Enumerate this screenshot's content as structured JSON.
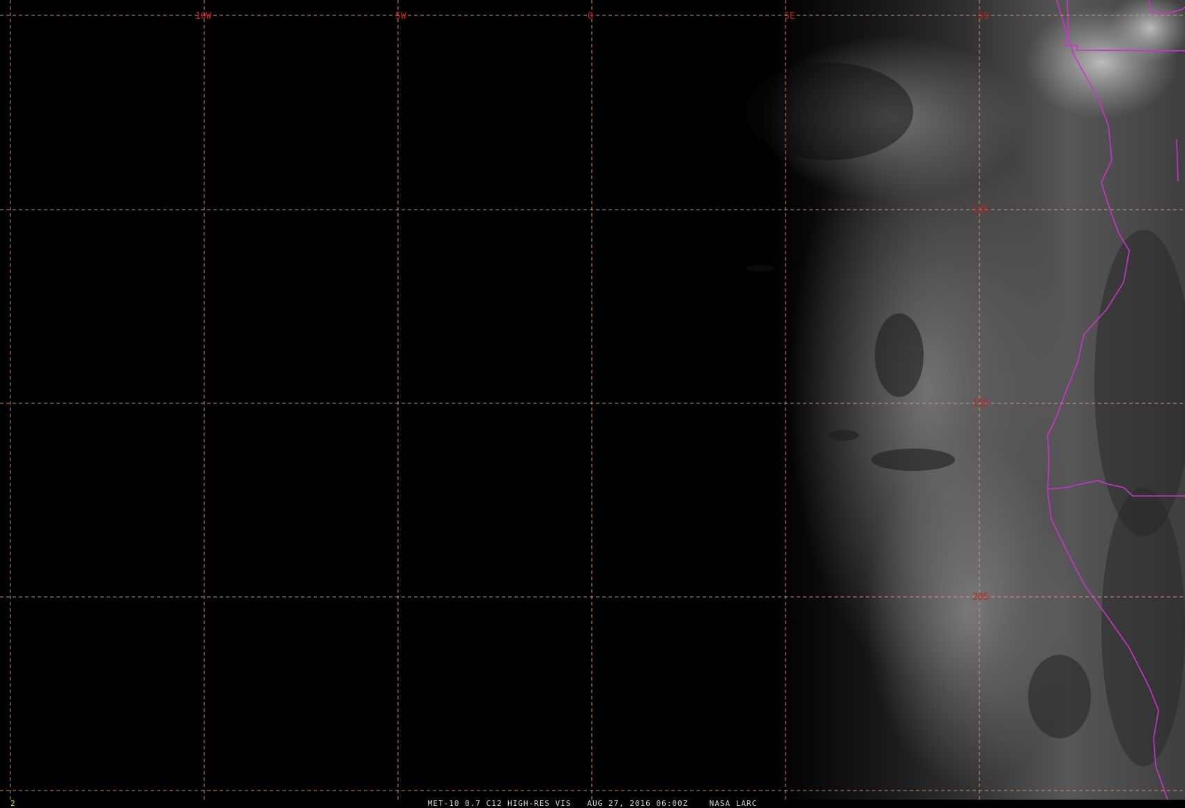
{
  "map": {
    "longitude_labels": [
      "10W",
      "5W",
      "0",
      "5E",
      "5S"
    ],
    "latitude_labels": [
      "10S",
      "15S",
      "20S"
    ],
    "colors": {
      "background": "#000000",
      "grid_lines": "#d9a07a",
      "grid_labels": "#c42020",
      "political_borders": "#cc33cc",
      "cloud": "#9a9a9a"
    }
  },
  "status_bar": {
    "frame_number": "2",
    "caption": "MET-10 0.7 C12 HIGH-RES VIS   AUG 27, 2016 06:00Z    NASA LARC"
  }
}
